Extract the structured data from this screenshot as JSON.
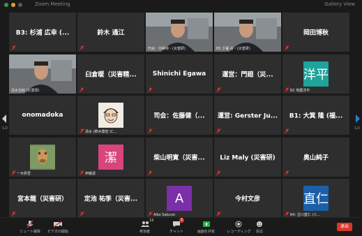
{
  "window": {
    "title": "Zoom Meeting",
    "view_label": "Gallery View"
  },
  "colors": {
    "tile_bg": "#2e2e2e",
    "active_border": "#cfe63a",
    "muted_red": "#e0312b",
    "leave_red": "#d9372b",
    "nav_blue": "#2a7bd6"
  },
  "tiles": [
    {
      "name": "B3: 杉浦 広幸 (...",
      "label": "",
      "muted": true,
      "type": "name"
    },
    {
      "name": "鈴木 通江",
      "label": "",
      "muted": true,
      "type": "name"
    },
    {
      "name": "",
      "label": "司会：中曲林・(災害研)",
      "muted": false,
      "type": "video"
    },
    {
      "name": "",
      "label": "B5 夕暮 谷・(災害研)",
      "muted": false,
      "type": "video"
    },
    {
      "name": "岡田博秋",
      "label": "",
      "muted": true,
      "type": "name"
    },
    {
      "name": "",
      "label": "清水治郎 (災害研)",
      "muted": false,
      "type": "video",
      "active": true
    },
    {
      "name": "臼倉暖（災害精...",
      "label": "",
      "muted": true,
      "type": "name"
    },
    {
      "name": "Shinichi Egawa",
      "label": "",
      "muted": true,
      "type": "name"
    },
    {
      "name": "運営：門廻（災...",
      "label": "",
      "muted": true,
      "type": "name"
    },
    {
      "name": "",
      "label": "B2 地震洋平",
      "muted": true,
      "type": "avatar",
      "avatar_text": "洋平",
      "avatar_color": "#1fa39b"
    },
    {
      "name": "onomadoka",
      "label": "",
      "muted": false,
      "type": "name"
    },
    {
      "name": "",
      "label": "清水 (柿木尊宏 (C...",
      "muted": true,
      "type": "picture"
    },
    {
      "name": "司会：佐藤健（...",
      "label": "",
      "muted": true,
      "type": "name"
    },
    {
      "name": "運営: Gerster Ju...",
      "label": "",
      "muted": true,
      "type": "name"
    },
    {
      "name": "B1: 大箕 隆 (福...",
      "label": "",
      "muted": true,
      "type": "name"
    },
    {
      "name": "",
      "label": "一木昇吾",
      "muted": true,
      "type": "giraffe"
    },
    {
      "name": "",
      "label": "伊藤潔",
      "muted": true,
      "type": "avatar",
      "avatar_text": "潔",
      "avatar_color": "#d9457a"
    },
    {
      "name": "柴山明寛（災害...",
      "label": "",
      "muted": true,
      "type": "name"
    },
    {
      "name": "Liz Maly (災害研)",
      "label": "",
      "muted": true,
      "type": "name"
    },
    {
      "name": "奥山純子",
      "label": "",
      "muted": true,
      "type": "name"
    },
    {
      "name": "宮本龍（災害研）",
      "label": "",
      "muted": true,
      "type": "name"
    },
    {
      "name": "定池 祐季（災害...",
      "label": "",
      "muted": true,
      "type": "name"
    },
    {
      "name": "",
      "label": "Aiko Sakurai",
      "muted": true,
      "type": "avatar",
      "avatar_text": "A",
      "avatar_color": "#7b2fa8"
    },
    {
      "name": "今村文彦",
      "label": "",
      "muted": true,
      "type": "name"
    },
    {
      "name": "",
      "label": "B4: 古川直仁 (人...",
      "muted": true,
      "type": "avatar",
      "avatar_text": "直仁",
      "avatar_color": "#1a5fa8"
    }
  ],
  "pagination": {
    "left_page": "1/2",
    "right_page": "1/2"
  },
  "toolbar": {
    "mute": "ミュート解除",
    "video": "ビデオの開始",
    "participants": "参加者",
    "participants_count": "16",
    "chat": "チャット",
    "chat_badge": "3",
    "share": "画面を共有",
    "record": "レコーディング",
    "reactions": "反応",
    "leave": "退出"
  }
}
